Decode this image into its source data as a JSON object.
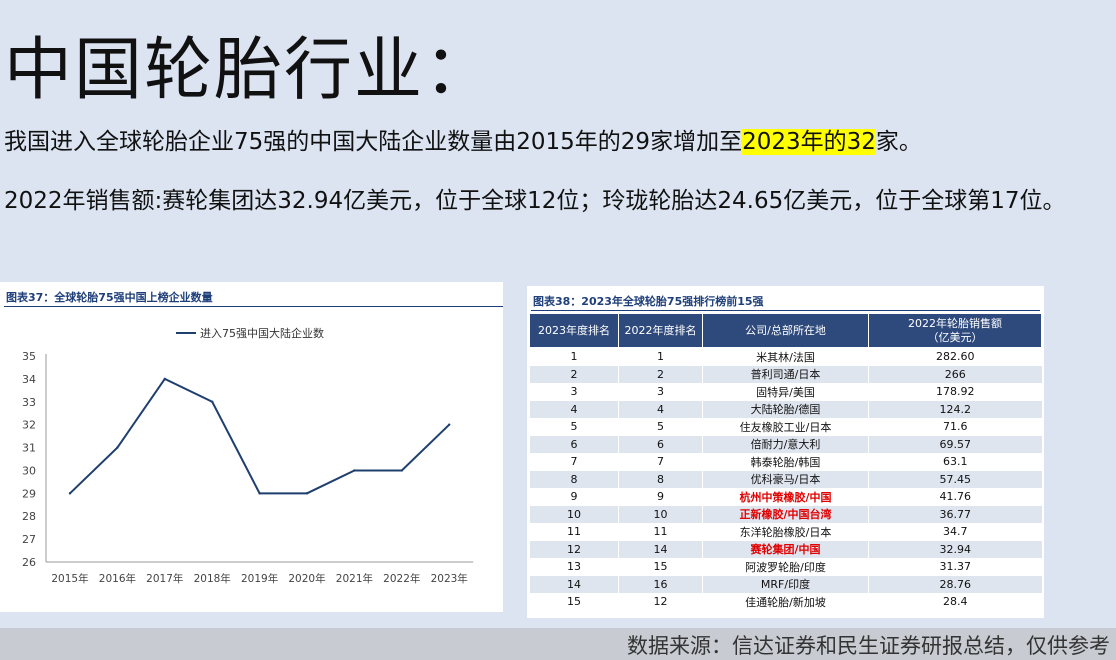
{
  "title": "中国轮胎行业：",
  "para1": {
    "before": "我国进入全球轮胎企业75强的中国大陆企业数量由2015年的29家增加至",
    "highlight": "2023年的32",
    "after": "家。"
  },
  "para2": "2022年销售额:赛轮集团达32.94亿美元，位于全球12位；玲珑轮胎达24.65亿美元，位于全球第17位。",
  "fig37": {
    "title": "图表37：全球轮胎75强中国上榜企业数量",
    "chart_data": {
      "type": "line",
      "categories": [
        "2015年",
        "2016年",
        "2017年",
        "2018年",
        "2019年",
        "2020年",
        "2021年",
        "2022年",
        "2023年"
      ],
      "series": [
        {
          "name": "进入75强中国大陆企业数",
          "values": [
            29,
            31,
            34,
            33,
            29,
            29,
            30,
            30,
            32
          ]
        }
      ],
      "ylim": [
        26,
        35
      ],
      "yticks": [
        "35",
        "34",
        "33",
        "32",
        "31",
        "30",
        "29",
        "28",
        "27",
        "26"
      ],
      "legend": "top",
      "grid": false,
      "line_color": "#1f3f6e"
    }
  },
  "fig38": {
    "title": "图表38：2023年全球轮胎75强排行榜前15强",
    "headers": [
      "2023年度排名",
      "2022年度排名",
      "公司/总部所在地",
      "2022年轮胎销售额",
      "（亿美元）"
    ],
    "rows": [
      {
        "r23": "1",
        "r22": "1",
        "company": "米其林/法国",
        "sales": "282.60",
        "red": false
      },
      {
        "r23": "2",
        "r22": "2",
        "company": "普利司通/日本",
        "sales": "266",
        "red": false
      },
      {
        "r23": "3",
        "r22": "3",
        "company": "固特异/美国",
        "sales": "178.92",
        "red": false
      },
      {
        "r23": "4",
        "r22": "4",
        "company": "大陆轮胎/德国",
        "sales": "124.2",
        "red": false
      },
      {
        "r23": "5",
        "r22": "5",
        "company": "住友橡胶工业/日本",
        "sales": "71.6",
        "red": false
      },
      {
        "r23": "6",
        "r22": "6",
        "company": "倍耐力/意大利",
        "sales": "69.57",
        "red": false
      },
      {
        "r23": "7",
        "r22": "7",
        "company": "韩泰轮胎/韩国",
        "sales": "63.1",
        "red": false
      },
      {
        "r23": "8",
        "r22": "8",
        "company": "优科豪马/日本",
        "sales": "57.45",
        "red": false
      },
      {
        "r23": "9",
        "r22": "9",
        "company": "杭州中策橡胶/中国",
        "sales": "41.76",
        "red": true
      },
      {
        "r23": "10",
        "r22": "10",
        "company": "正新橡胶/中国台湾",
        "sales": "36.77",
        "red": true
      },
      {
        "r23": "11",
        "r22": "11",
        "company": "东洋轮胎橡胶/日本",
        "sales": "34.7",
        "red": false
      },
      {
        "r23": "12",
        "r22": "14",
        "company": "赛轮集团/中国",
        "sales": "32.94",
        "red": true
      },
      {
        "r23": "13",
        "r22": "15",
        "company": "阿波罗轮胎/印度",
        "sales": "31.37",
        "red": false
      },
      {
        "r23": "14",
        "r22": "16",
        "company": "MRF/印度",
        "sales": "28.76",
        "red": false
      },
      {
        "r23": "15",
        "r22": "12",
        "company": "佳通轮胎/新加坡",
        "sales": "28.4",
        "red": false
      }
    ]
  },
  "footer": "数据来源：信达证券和民生证券研报总结，仅供参考"
}
